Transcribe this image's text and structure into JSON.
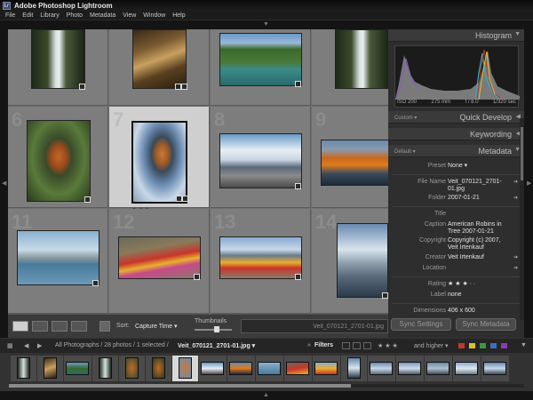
{
  "window": {
    "title": "Adobe Photoshop Lightroom",
    "app_icon": "Lr"
  },
  "menu": [
    "File",
    "Edit",
    "Library",
    "Photo",
    "Metadata",
    "View",
    "Window",
    "Help"
  ],
  "grid": {
    "cell_numbers": [
      "",
      "",
      "",
      "",
      "6",
      "7",
      "8",
      "9",
      "11",
      "12",
      "13",
      "14"
    ],
    "selected_stars": "★★★"
  },
  "toolbar": {
    "sort_label": "Sort:",
    "sort_value": "Capture Time ▾",
    "thumbnails_label": "Thumbnails",
    "filename_display": "Veit_070121_2701-01.jpg"
  },
  "panel": {
    "histogram_title": "Histogram",
    "histogram_info": [
      "ISO 200",
      "275 mm",
      "f / 8.0",
      "1/320 sec"
    ],
    "quick_develop": {
      "preset": "Custom ▾",
      "title": "Quick Develop"
    },
    "keywording_title": "Keywording",
    "metadata": {
      "preset": "Default ▾",
      "title": "Metadata"
    },
    "fields": {
      "preset_label": "Preset",
      "preset_value": "None ▾",
      "filename_label": "File Name",
      "filename_value": "Veit_070121_2701-01.jpg",
      "folder_label": "Folder",
      "folder_value": "2007-01-21",
      "title_label": "Title",
      "title_value": "",
      "caption_label": "Caption",
      "caption_value": "American Robins in Tree 2007-01-21",
      "copyright_label": "Copyright",
      "copyright_value": "Copyright (c) 2007, Veit Irtenkauf",
      "creator_label": "Creator",
      "creator_value": "Veit Irtenkauf",
      "location_label": "Location",
      "location_value": "",
      "rating_label": "Rating",
      "rating_value": "★ ★ ★ · ·",
      "label_label": "Label",
      "label_value": "none",
      "dimensions_label": "Dimensions",
      "dimensions_value": "406 x 600"
    },
    "sync_settings": "Sync Settings",
    "sync_metadata": "Sync Metadata"
  },
  "filmstrip": {
    "path": "All Photographs / 28 photos / 1 selected / ",
    "current_file": "Veit_070121_2701-01.jpg ▾",
    "filters_label": "Filters",
    "rating_filter": "★ ★ ★",
    "higher_label": "and higher ▾",
    "label_colors": [
      "#c0392b",
      "#d4c233",
      "#3a9a3a",
      "#3a6fc0",
      "#8a3ab0"
    ]
  }
}
